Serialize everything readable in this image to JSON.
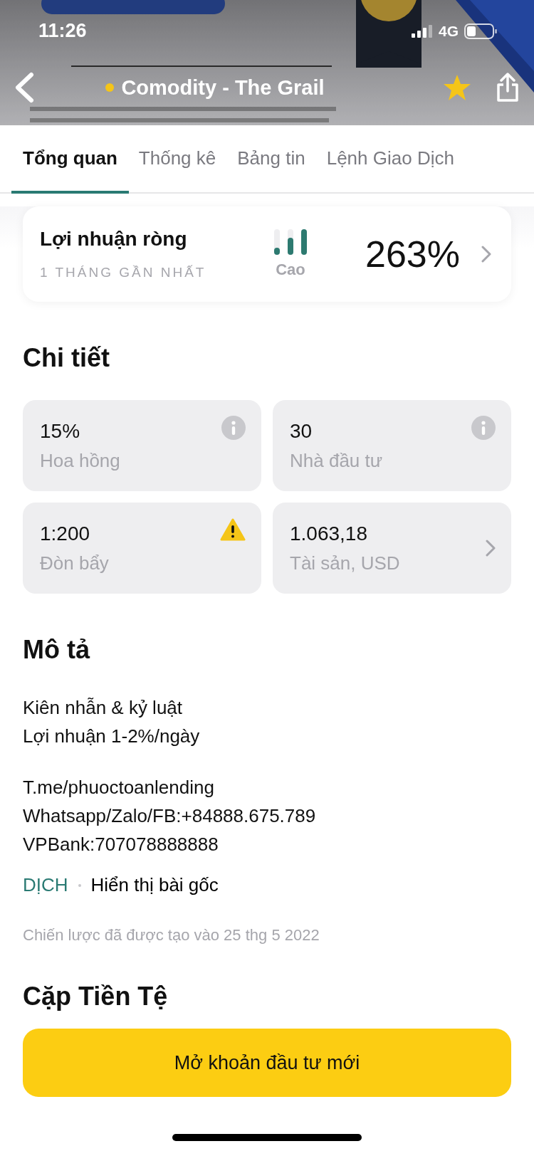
{
  "status_bar": {
    "time": "11:26",
    "network": "4G"
  },
  "header": {
    "title": "Comodity - The Grail",
    "favorite": true
  },
  "tabs": [
    {
      "label": "Tổng quan",
      "selected": true
    },
    {
      "label": "Thống kê",
      "selected": false
    },
    {
      "label": "Bảng tin",
      "selected": false
    },
    {
      "label": "Lệnh Giao Dịch",
      "selected": false
    }
  ],
  "profit_card": {
    "title": "Lợi nhuận ròng",
    "period": "1 THÁNG GẦN NHẤT",
    "risk_label": "Cao",
    "value": "263%"
  },
  "details": {
    "title": "Chi tiết",
    "items": [
      {
        "value": "15%",
        "label": "Hoa hồng",
        "kind": "info"
      },
      {
        "value": "30",
        "label": "Nhà đầu tư",
        "kind": "info"
      },
      {
        "value": "1:200",
        "label": "Đòn bẩy",
        "kind": "warning"
      },
      {
        "value": "1.063,18",
        "label": "Tài sản, USD",
        "kind": "link"
      }
    ]
  },
  "description": {
    "title": "Mô tả",
    "paragraphs": [
      [
        "Kiên nhẫn & kỷ luật",
        "Lợi nhuận 1-2%/ngày"
      ],
      [
        "T.me/phuoctoanlending",
        "Whatsapp/Zalo/FB:+84888.675.789",
        "VPBank:707078888888"
      ]
    ],
    "translate_link": "DỊCH",
    "original_link": "Hiển thị bài gốc",
    "created": "Chiến lược đã được tạo vào 25 thg 5 2022"
  },
  "pairs": {
    "title": "Cặp Tiền Tệ"
  },
  "action_button": "Mở khoản đầu tư mới"
}
